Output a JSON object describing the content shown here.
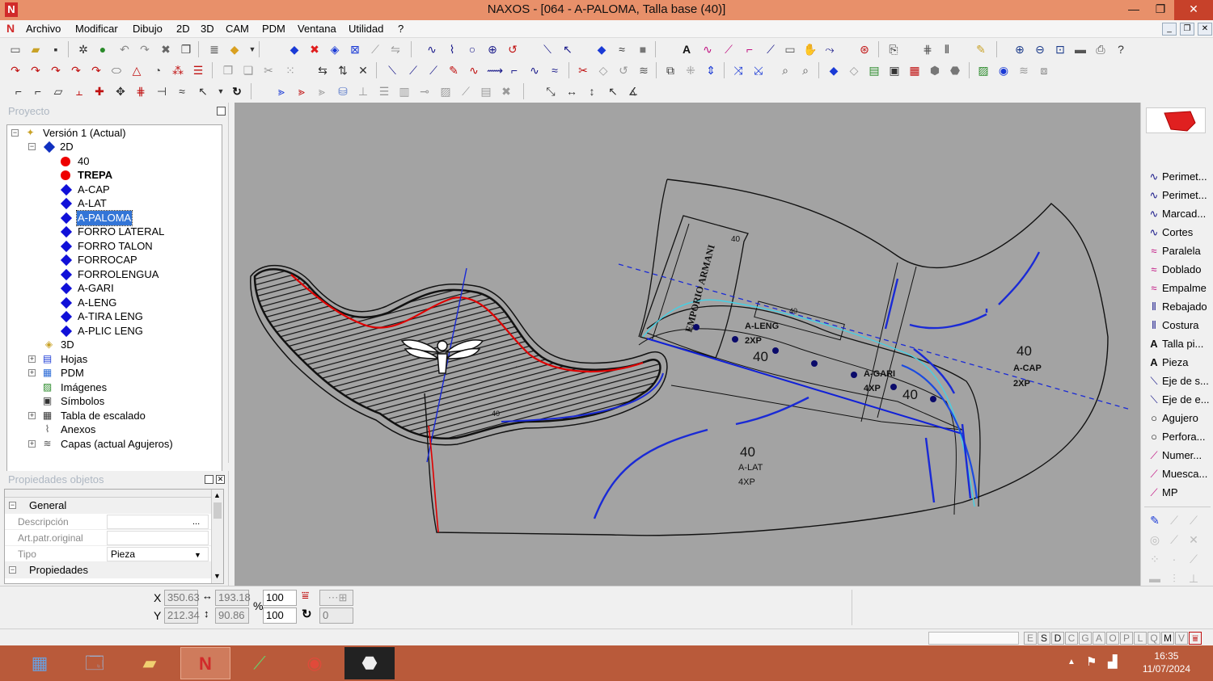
{
  "window": {
    "title": "NAXOS - [064 - A-PALOMA, Talla base (40)]",
    "app_icon": "N",
    "minimize_glyph": "—",
    "maximize_glyph": "❐",
    "close_glyph": "✕"
  },
  "menu": {
    "logo": "N",
    "items": [
      "Archivo",
      "Modificar",
      "Dibujo",
      "2D",
      "3D",
      "CAM",
      "PDM",
      "Ventana",
      "Utilidad",
      "?"
    ],
    "mdi_min": "_",
    "mdi_restore": "❐",
    "mdi_close": "✕"
  },
  "project_panel": {
    "title": "Proyecto",
    "tree": {
      "root": "Versión 1 (Actual)",
      "node_2d": "2D",
      "size_40": "40",
      "trepa": "TREPA",
      "pieces": [
        "A-CAP",
        "A-LAT",
        "A-PALOMA",
        "FORRO LATERAL",
        "FORRO TALON",
        "FORROCAP",
        "FORROLENGUA",
        "A-GARI",
        "A-LENG",
        "A-TIRA LENG",
        "A-PLIC LENG"
      ],
      "selected_piece": "A-PALOMA",
      "node_3d": "3D",
      "hojas": "Hojas",
      "pdm": "PDM",
      "imagenes": "Imágenes",
      "simbolos": "Símbolos",
      "tabla": "Tabla de escalado",
      "anexos": "Anexos",
      "capas": "Capas (actual Agujeros)"
    }
  },
  "properties_panel": {
    "title": "Propiedades objetos",
    "cat_general": "General",
    "rows": [
      {
        "label": "Descripción",
        "value": ""
      },
      {
        "label": "Art.patr.original",
        "value": ""
      },
      {
        "label": "Tipo",
        "value": "Pieza"
      }
    ],
    "cat_props": "Propiedades",
    "ellipsis": "..."
  },
  "canvas_labels": {
    "size_40": "40",
    "a_leng": "A-LENG",
    "a_leng_qty": "2XP",
    "a_gari": "A-GARI",
    "a_gari_qty": "4XP",
    "a_cap": "A-CAP",
    "a_cap_qty": "2XP",
    "a_lat": "A-LAT",
    "a_lat_qty": "4XP",
    "brand_text": "EMPORIO ARMANI",
    "small_40": "40"
  },
  "right_tools": [
    {
      "label": "Perimet...",
      "icon": "curve-icon"
    },
    {
      "label": "Perimet...",
      "icon": "curve-icon"
    },
    {
      "label": "Marcad...",
      "icon": "curve-icon"
    },
    {
      "label": "Cortes",
      "icon": "curve-icon"
    },
    {
      "label": "Paralela",
      "icon": "parallel-icon"
    },
    {
      "label": "Doblado",
      "icon": "fold-icon"
    },
    {
      "label": "Empalme",
      "icon": "join-icon"
    },
    {
      "label": "Rebajado",
      "icon": "skive-icon"
    },
    {
      "label": "Costura",
      "icon": "seam-icon"
    },
    {
      "label": "Talla pi...",
      "icon": "text-a-icon"
    },
    {
      "label": "Pieza",
      "icon": "text-a-icon"
    },
    {
      "label": "Eje de s...",
      "icon": "axis-icon"
    },
    {
      "label": "Eje de e...",
      "icon": "axis-icon"
    },
    {
      "label": "Agujero",
      "icon": "circle-icon"
    },
    {
      "label": "Perfora...",
      "icon": "circle-icon"
    },
    {
      "label": "Numer...",
      "icon": "pen-icon"
    },
    {
      "label": "Muesca...",
      "icon": "pen-icon"
    },
    {
      "label": "MP",
      "icon": "pen-icon"
    }
  ],
  "coords": {
    "x_label": "X",
    "y_label": "Y",
    "x": "350.63",
    "y": "212.34",
    "width": "193.18",
    "height": "90.86",
    "percent_sign": "%",
    "scale_x": "100",
    "scale_y": "100",
    "rotation": "0"
  },
  "status_keys": [
    "E",
    "S",
    "D",
    "C",
    "G",
    "A",
    "O",
    "P",
    "L",
    "Q",
    "M",
    "V"
  ],
  "taskbar": {
    "time": "16:35",
    "date": "11/07/2024"
  },
  "colors": {
    "titlebar": "#e8906a",
    "canvas_bg": "#a3a3a3",
    "selection": "#3375d7",
    "taskbar": "#b95a3a",
    "piece_red": "#e00000",
    "piece_blue": "#1010d8"
  }
}
